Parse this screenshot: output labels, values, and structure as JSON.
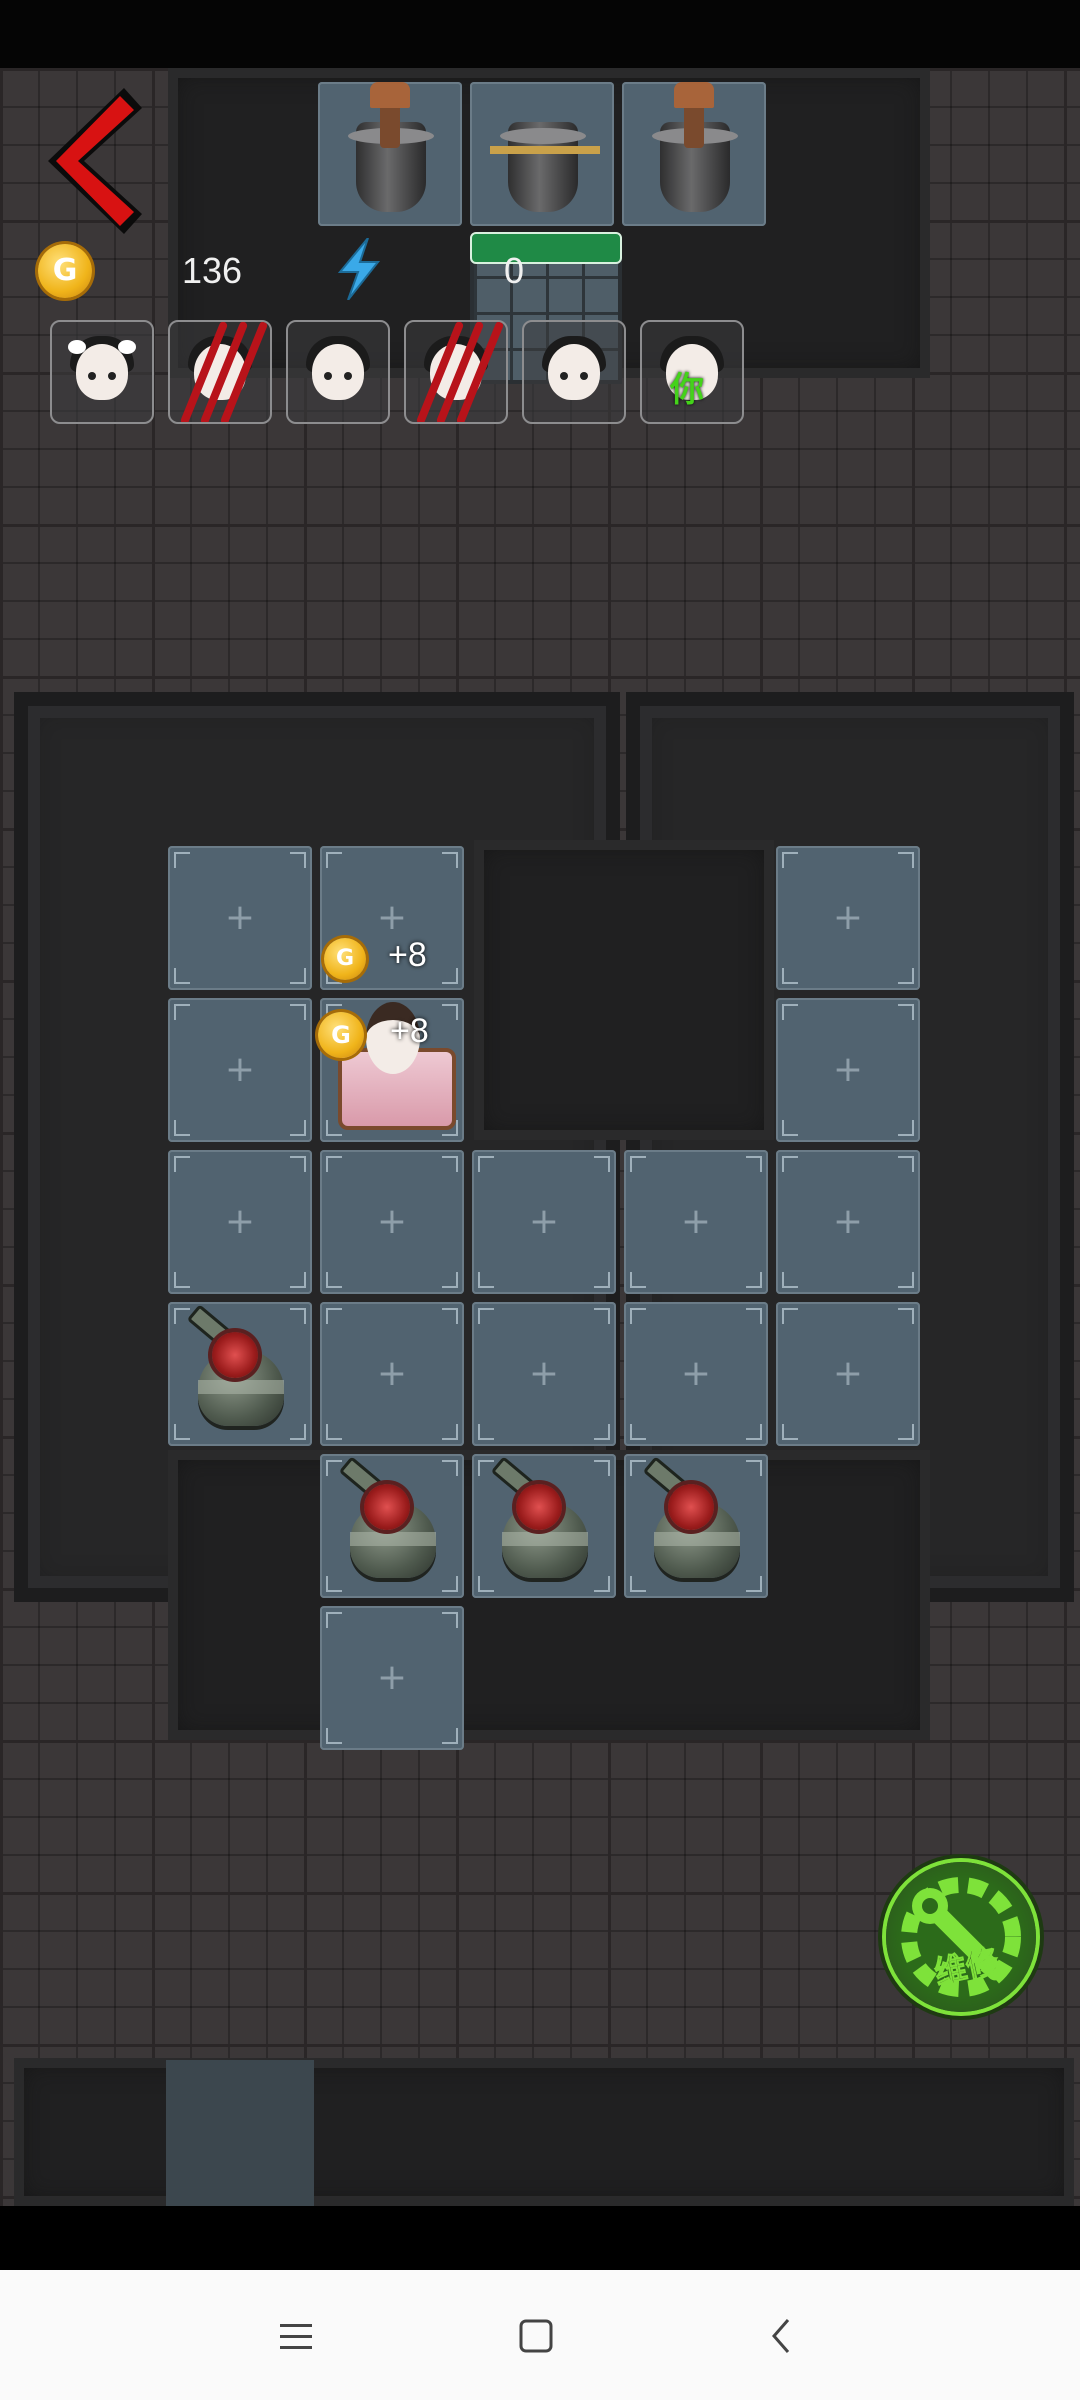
{
  "hud": {
    "coins": "136",
    "energy": "0",
    "back_icon": "chevron-left-icon",
    "coin_symbol": "G",
    "energy_icon": "lightning-icon"
  },
  "players": [
    {
      "name": "player-1",
      "state": "alive"
    },
    {
      "name": "player-2",
      "state": "clawed"
    },
    {
      "name": "player-3",
      "state": "alive"
    },
    {
      "name": "player-4",
      "state": "clawed"
    },
    {
      "name": "player-5",
      "state": "alive"
    },
    {
      "name": "player-you",
      "state": "alive",
      "label": "你"
    }
  ],
  "popups": [
    "+8",
    "+8"
  ],
  "tile_plus": "+",
  "repair_button": {
    "label": "维修",
    "accent": "#7ee23a"
  },
  "navbar": {
    "menu_icon": "menu-icon",
    "home_icon": "home-icon",
    "back_icon": "back-icon"
  },
  "colors": {
    "tile": "#516370",
    "energy_bar": "#1f8a46",
    "back_arrow": "#d01010",
    "coin": "#f0b41a"
  }
}
